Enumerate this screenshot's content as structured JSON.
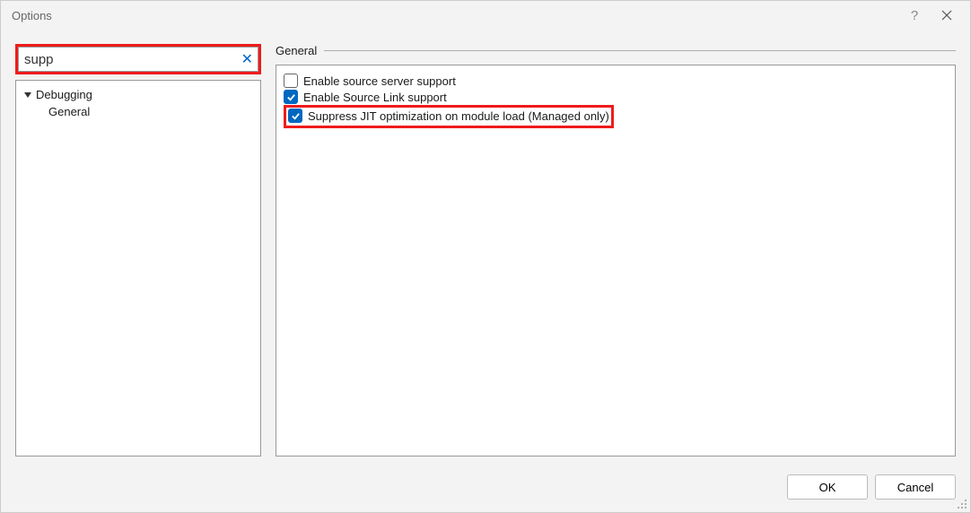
{
  "title": "Options",
  "search": {
    "value": "supp"
  },
  "tree": {
    "root": {
      "label": "Debugging"
    },
    "child": {
      "label": "General"
    }
  },
  "section": {
    "heading": "General"
  },
  "options": {
    "opt1": {
      "label": "Enable source server support",
      "checked": false
    },
    "opt2": {
      "label": "Enable Source Link support",
      "checked": true
    },
    "opt3": {
      "label": "Suppress JIT optimization on module load (Managed only)",
      "checked": true
    }
  },
  "buttons": {
    "ok": "OK",
    "cancel": "Cancel"
  }
}
